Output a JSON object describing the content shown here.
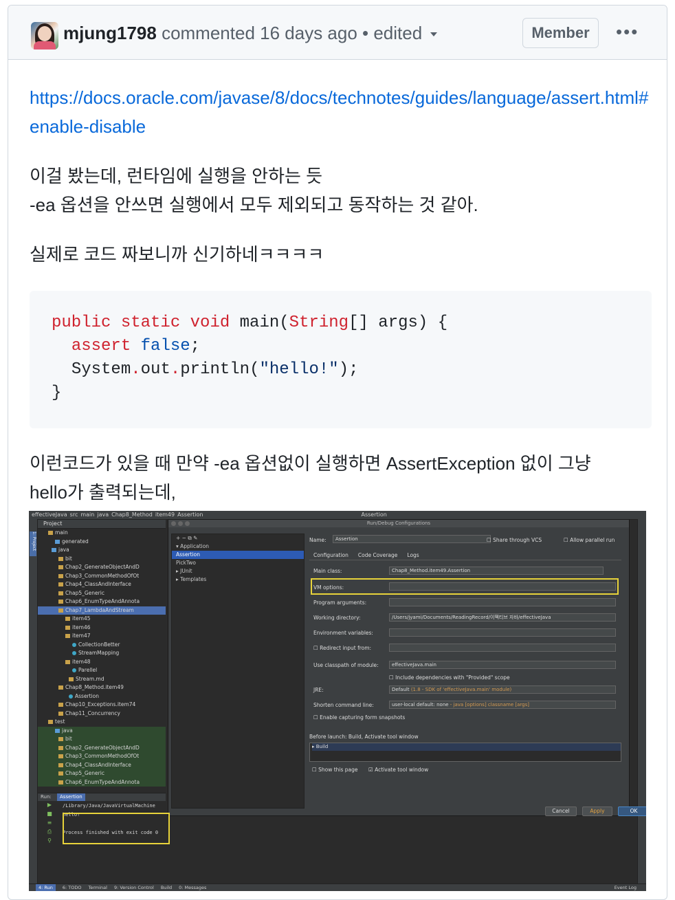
{
  "comment": {
    "username": "mjung1798",
    "meta": "commented 16 days ago • edited",
    "role_badge": "Member",
    "more_label": "•••",
    "link": "https://docs.oracle.com/javase/8/docs/technotes/guides/language/assert.html#enable-disable",
    "para1_line1": "이걸 봤는데, 런타임에 실행을 안하는 듯",
    "para1_line2": "-ea 옵션을 안쓰면 실행에서 모두 제외되고 동작하는 것 같아.",
    "para2": "실제로 코드 짜보니까 신기하네ㅋㅋㅋㅋ",
    "code": {
      "line1_kw": "public static void",
      "line1_name": " main(",
      "line1_type": "String",
      "line1_rest": "[] args) {",
      "line2_kw": "assert",
      "line2_val": "false",
      "line2_end": ";",
      "line3_a": "System",
      "line3_b": "out",
      "line3_c": "println(",
      "line3_str": "\"hello!\"",
      "line3_end": ");",
      "line4": "}"
    },
    "para3_line1": "이런코드가 있을 때 만약 -ea 옵션없이 실행하면 AssertException 없이 그냥",
    "para3_line2": "hello가 출력되는데,"
  },
  "ide": {
    "nav": [
      "effectiveJava",
      "src",
      "main",
      "java",
      "Chap8_Method",
      "item49",
      "Assertion"
    ],
    "nav_right": "Assertion",
    "project_header": "Project",
    "tree": [
      {
        "label": "main",
        "indent": 3,
        "icon": "folder",
        "cls": ""
      },
      {
        "label": "generated",
        "indent": 5,
        "icon": "folder-blue",
        "cls": ""
      },
      {
        "label": "java",
        "indent": 4,
        "icon": "folder-blue",
        "cls": ""
      },
      {
        "label": "bit",
        "indent": 6,
        "icon": "folder",
        "cls": ""
      },
      {
        "label": "Chap2_GenerateObjectAndD",
        "indent": 6,
        "icon": "folder",
        "cls": ""
      },
      {
        "label": "Chap3_CommonMethodOfOt",
        "indent": 6,
        "icon": "folder",
        "cls": ""
      },
      {
        "label": "Chap4_ClassAndInterface",
        "indent": 6,
        "icon": "folder",
        "cls": ""
      },
      {
        "label": "Chap5_Generic",
        "indent": 6,
        "icon": "folder",
        "cls": ""
      },
      {
        "label": "Chap6_EnumTypeAndAnnota",
        "indent": 6,
        "icon": "folder",
        "cls": ""
      },
      {
        "label": "Chap7_LambdaAndStream",
        "indent": 6,
        "icon": "folder",
        "cls": "sel"
      },
      {
        "label": "item45",
        "indent": 8,
        "icon": "folder",
        "cls": ""
      },
      {
        "label": "item46",
        "indent": 8,
        "icon": "folder",
        "cls": ""
      },
      {
        "label": "item47",
        "indent": 8,
        "icon": "folder",
        "cls": ""
      },
      {
        "label": "CollectionBetter",
        "indent": 10,
        "icon": "class",
        "cls": ""
      },
      {
        "label": "StreamMapping",
        "indent": 10,
        "icon": "class",
        "cls": ""
      },
      {
        "label": "item48",
        "indent": 8,
        "icon": "folder",
        "cls": ""
      },
      {
        "label": "Parellel",
        "indent": 10,
        "icon": "class",
        "cls": ""
      },
      {
        "label": "Stream.md",
        "indent": 9,
        "icon": "file",
        "cls": ""
      },
      {
        "label": "Chap8_Method.item49",
        "indent": 6,
        "icon": "folder",
        "cls": ""
      },
      {
        "label": "Assertion",
        "indent": 9,
        "icon": "class",
        "cls": ""
      },
      {
        "label": "Chap10_Exceptions.item74",
        "indent": 6,
        "icon": "folder",
        "cls": ""
      },
      {
        "label": "Chap11_Concurrency",
        "indent": 6,
        "icon": "folder",
        "cls": ""
      },
      {
        "label": "test",
        "indent": 3,
        "icon": "folder",
        "cls": ""
      },
      {
        "label": "java",
        "indent": 5,
        "icon": "folder-blue",
        "cls": "green"
      },
      {
        "label": "bit",
        "indent": 6,
        "icon": "folder",
        "cls": "green"
      },
      {
        "label": "Chap2_GenerateObjectAndD",
        "indent": 6,
        "icon": "folder",
        "cls": "green"
      },
      {
        "label": "Chap3_CommonMethodOfOt",
        "indent": 6,
        "icon": "folder",
        "cls": "green"
      },
      {
        "label": "Chap4_ClassAndInterface",
        "indent": 6,
        "icon": "folder",
        "cls": "green"
      },
      {
        "label": "Chap5_Generic",
        "indent": 6,
        "icon": "folder",
        "cls": "green"
      },
      {
        "label": "Chap6_EnumTypeAndAnnota",
        "indent": 6,
        "icon": "folder",
        "cls": "green"
      }
    ],
    "dialog": {
      "title": "Run/Debug Configurations",
      "left_items": [
        {
          "label": "▾ Application",
          "cls": ""
        },
        {
          "label": "    Assertion",
          "cls": "sel"
        },
        {
          "label": "    PickTwo",
          "cls": ""
        },
        {
          "label": "▸ JUnit",
          "cls": ""
        },
        {
          "label": "▸ Templates",
          "cls": ""
        }
      ],
      "name_label": "Name:",
      "name_value": "Assertion",
      "share_label": "Share through VCS",
      "parallel_label": "Allow parallel run",
      "tabs": [
        "Configuration",
        "Code Coverage",
        "Logs"
      ],
      "main_class_label": "Main class:",
      "main_class_value": "Chap8_Method.item49.Assertion",
      "vm_label": "VM options:",
      "args_label": "Program arguments:",
      "wd_label": "Working directory:",
      "wd_value": "/Users/jyami/Documents/ReadingRecord/이펙티브 자바/effectiveJava",
      "env_label": "Environment variables:",
      "redirect_label": "Redirect input from:",
      "classpath_label": "Use classpath of module:",
      "classpath_value": "effectiveJava.main",
      "provided_label": "Include dependencies with \"Provided\" scope",
      "jre_label": "JRE:",
      "jre_value": "Default",
      "jre_hint": "(1.8 - SDK of 'effectiveJava.main' module)",
      "shorten_label": "Shorten command line:",
      "shorten_value": "user-local default: none",
      "shorten_hint": "- java [options] classname [args]",
      "snapshots_label": "Enable capturing form snapshots",
      "before_launch": "Before launch: Build, Activate tool window",
      "build_item": "Build",
      "show_page": "Show this page",
      "activate_tool": "Activate tool window",
      "cancel": "Cancel",
      "apply": "Apply",
      "ok": "OK"
    },
    "run": {
      "header": "Run:",
      "tab": "Assertion",
      "console": "/Library/Java/JavaVirtualMachine\nhello!\n\nProcess finished with exit code 0"
    },
    "bottom": [
      "4: Run",
      "6: TODO",
      "Terminal",
      "9: Version Control",
      "Build",
      "0: Messages"
    ],
    "event_log": "Event Log"
  }
}
